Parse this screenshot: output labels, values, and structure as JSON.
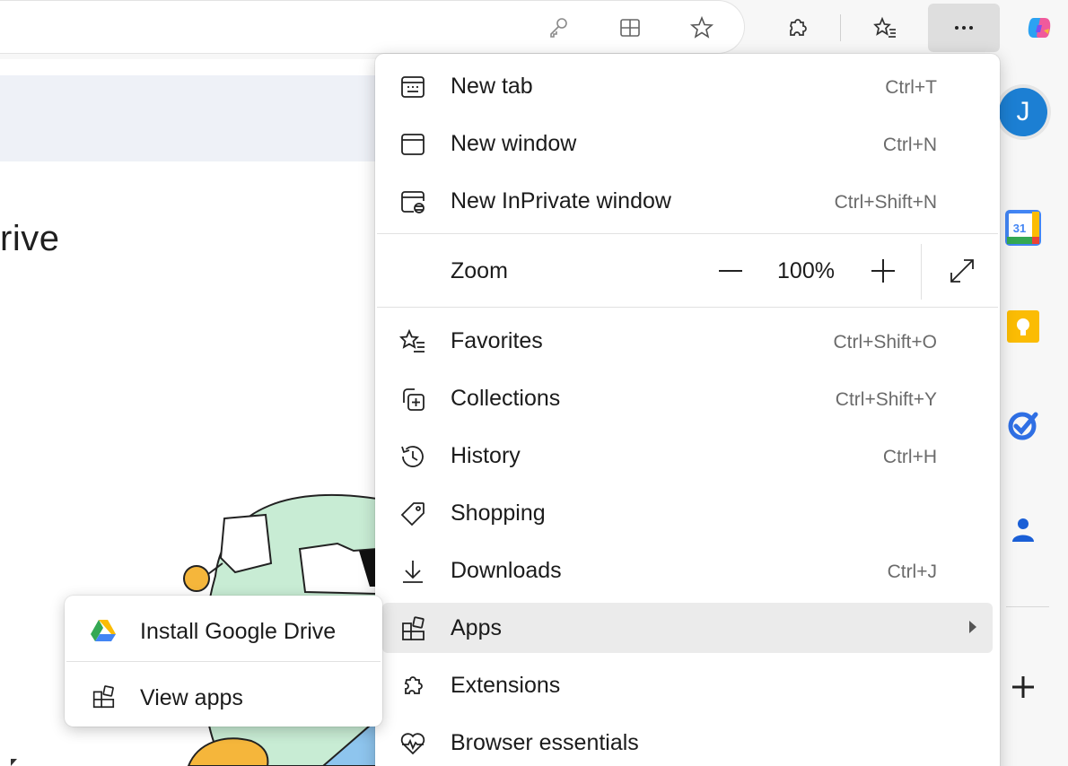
{
  "toolbar": {
    "icons": [
      "key-icon",
      "split-screen-icon",
      "favorite-star-icon",
      "extensions-icon",
      "favorites-icon",
      "more-icon",
      "copilot-icon"
    ]
  },
  "page": {
    "heading": "rive"
  },
  "sidebar": {
    "avatar_initial": "J",
    "calendar_day": "31",
    "items": [
      "google-calendar-icon",
      "google-keep-icon",
      "google-tasks-icon",
      "google-contacts-icon",
      "add-icon"
    ]
  },
  "menu": {
    "items": [
      {
        "label": "New tab",
        "shortcut": "Ctrl+T"
      },
      {
        "label": "New window",
        "shortcut": "Ctrl+N"
      },
      {
        "label": "New InPrivate window",
        "shortcut": "Ctrl+Shift+N"
      },
      {
        "label": "Favorites",
        "shortcut": "Ctrl+Shift+O"
      },
      {
        "label": "Collections",
        "shortcut": "Ctrl+Shift+Y"
      },
      {
        "label": "History",
        "shortcut": "Ctrl+H"
      },
      {
        "label": "Shopping",
        "shortcut": ""
      },
      {
        "label": "Downloads",
        "shortcut": "Ctrl+J"
      },
      {
        "label": "Apps",
        "shortcut": ""
      },
      {
        "label": "Extensions",
        "shortcut": ""
      },
      {
        "label": "Browser essentials",
        "shortcut": ""
      }
    ],
    "zoom": {
      "label": "Zoom",
      "value": "100%"
    }
  },
  "submenu": {
    "items": [
      {
        "label": "Install Google Drive"
      },
      {
        "label": "View apps"
      }
    ]
  },
  "colors": {
    "accent_blue": "#1c7fd3",
    "menu_hover": "#ebebeb"
  }
}
